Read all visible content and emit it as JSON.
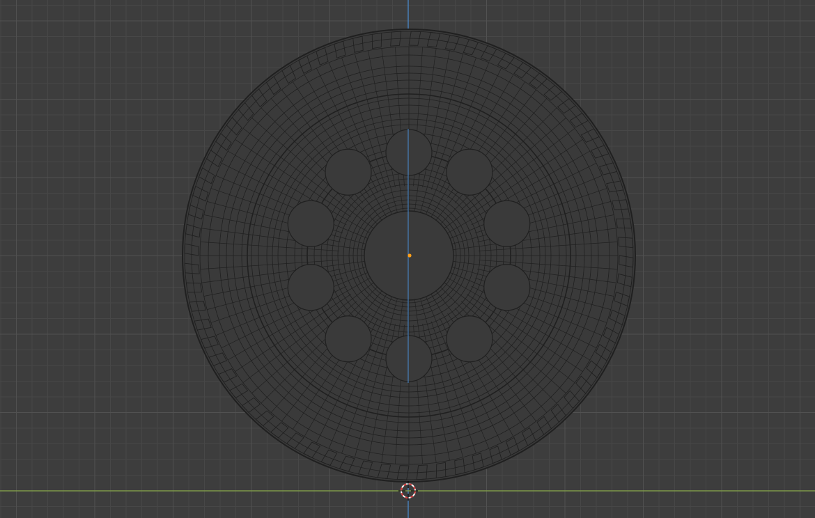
{
  "viewport": {
    "view": "front-orthographic",
    "background_color": "#3d3d3d",
    "grid_minor_color": "#474747",
    "grid_major_color": "#515151",
    "z_axis_color": "#4b8fd6",
    "x_axis_color": "#7f9a4a",
    "mesh_fill_color": "#3a3a3a",
    "wire_color": "#202020",
    "origin_color": "#ff9f1a",
    "cursor_color_a": "#ffffff",
    "cursor_color_b": "#d83a3a"
  },
  "object": {
    "type": "wheel-mesh",
    "display": "wireframe",
    "rim_hole_count": 10,
    "tread_block_count": 72
  },
  "icons": {
    "origin": "object-origin-dot",
    "cursor": "3d-cursor-icon"
  }
}
